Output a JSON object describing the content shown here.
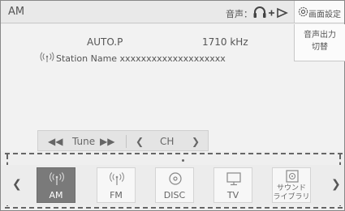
{
  "header": {
    "source": "AM",
    "audio_label": "音声：",
    "screen_settings": "画面設定"
  },
  "main": {
    "program_type": "AUTO.P",
    "frequency": "1710 kHz",
    "station_name": "Station Name xxxxxxxxxxxxxxxxxxxx",
    "audio_output_line1": "音声出力",
    "audio_output_line2": "切替"
  },
  "tune_bar": {
    "tune_label": "Tune",
    "ch_label": "CH"
  },
  "sources": [
    {
      "label": "AM",
      "icon": "radio-icon",
      "active": true
    },
    {
      "label": "FM",
      "icon": "radio-icon",
      "active": false
    },
    {
      "label": "DISC",
      "icon": "disc-icon",
      "active": false
    },
    {
      "label": "TV",
      "icon": "tv-icon",
      "active": false
    },
    {
      "label_line1": "サウンド",
      "label_line2": "ライブラリ",
      "icon": "sound-library-icon",
      "active": false
    }
  ],
  "colors": {
    "active_source_bg": "#7a7a7a",
    "background": "#efefef"
  }
}
